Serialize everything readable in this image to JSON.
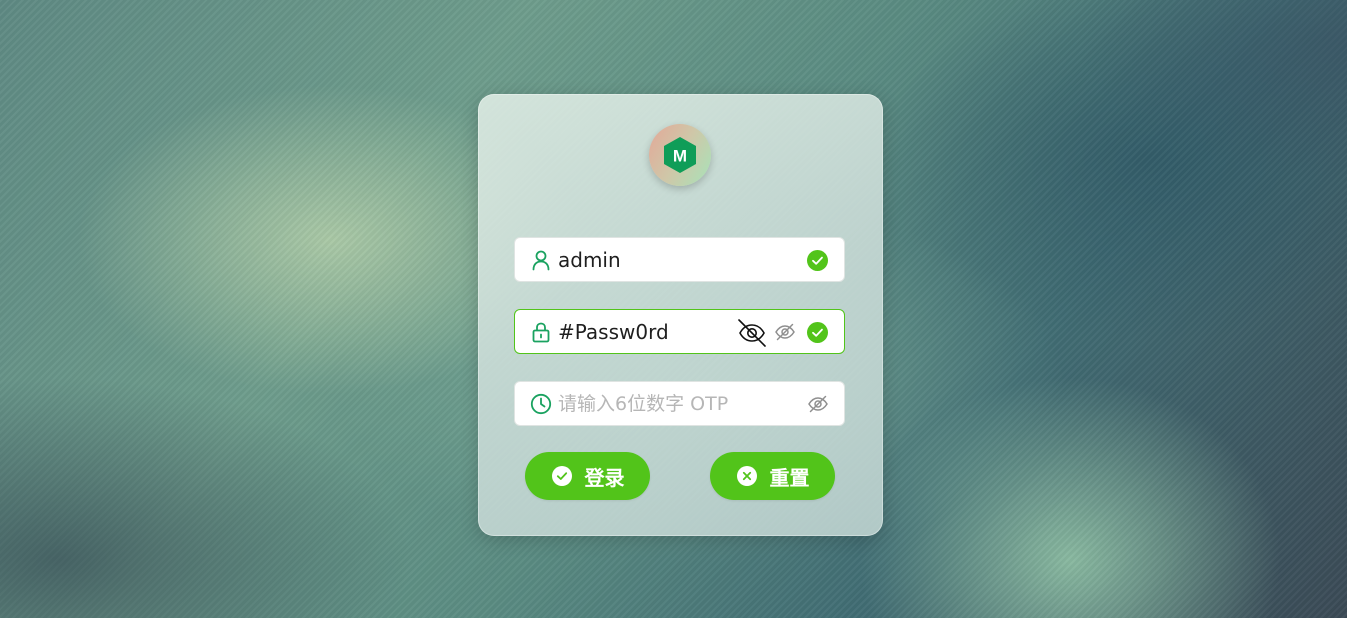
{
  "login_form": {
    "logo_letter": "M",
    "username": {
      "value": "admin",
      "status": "valid",
      "icon": "user-icon"
    },
    "password": {
      "value": "#Passw0rd",
      "status": "valid",
      "icon": "lock-icon",
      "visibility_toggle": "eye-off-icon"
    },
    "otp": {
      "value": "",
      "placeholder": "请输入6位数字 OTP",
      "icon": "clock-icon",
      "visibility_toggle": "eye-off-icon"
    },
    "buttons": {
      "login_label": "登录",
      "reset_label": "重置"
    }
  },
  "colors": {
    "accent": "#52c41a",
    "icon_green": "#1aa260",
    "logo_green": "#0f9d58"
  }
}
